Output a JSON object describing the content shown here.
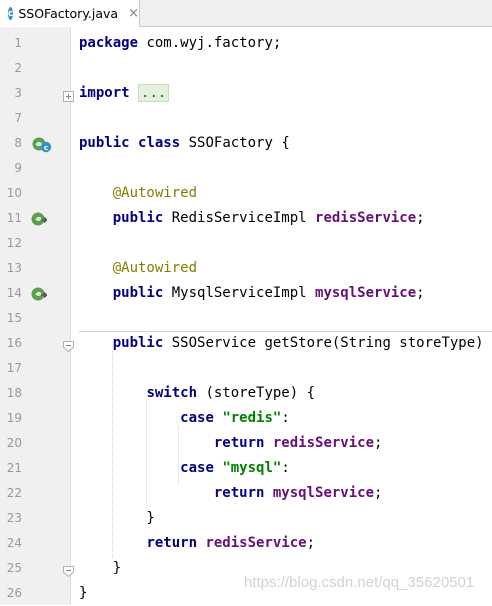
{
  "tab": {
    "label": "SSOFactory.java",
    "icon": "class-icon",
    "icon_letter": "c",
    "close_glyph": "×"
  },
  "lines": [
    {
      "n": "1",
      "tokens": [
        {
          "t": "package",
          "c": "kw"
        },
        {
          "t": " com.wyj.factory;"
        }
      ]
    },
    {
      "n": "2",
      "tokens": []
    },
    {
      "n": "3",
      "fold": "plus",
      "tokens": [
        {
          "t": "import",
          "c": "kw"
        },
        {
          "t": " "
        },
        {
          "t": "...",
          "c": "folded"
        }
      ]
    },
    {
      "n": "7",
      "tokens": []
    },
    {
      "n": "8",
      "icons": [
        "bean-icon",
        "class-icon"
      ],
      "tokens": [
        {
          "t": "public",
          "c": "kw"
        },
        {
          "t": " "
        },
        {
          "t": "class",
          "c": "kw"
        },
        {
          "t": " SSOFactory {"
        }
      ]
    },
    {
      "n": "9",
      "tokens": []
    },
    {
      "n": "10",
      "tokens": [
        {
          "t": "    "
        },
        {
          "t": "@Autowired",
          "c": "ann"
        }
      ]
    },
    {
      "n": "11",
      "icons": [
        "autowired-navigate-icon"
      ],
      "tokens": [
        {
          "t": "    "
        },
        {
          "t": "public",
          "c": "kw"
        },
        {
          "t": " RedisServiceImpl "
        },
        {
          "t": "redisService",
          "c": "fld"
        },
        {
          "t": ";"
        }
      ]
    },
    {
      "n": "12",
      "tokens": []
    },
    {
      "n": "13",
      "tokens": [
        {
          "t": "    "
        },
        {
          "t": "@Autowired",
          "c": "ann"
        }
      ]
    },
    {
      "n": "14",
      "icons": [
        "autowired-navigate-icon"
      ],
      "tokens": [
        {
          "t": "    "
        },
        {
          "t": "public",
          "c": "kw"
        },
        {
          "t": " MysqlServiceImpl "
        },
        {
          "t": "mysqlService",
          "c": "fld"
        },
        {
          "t": ";"
        }
      ]
    },
    {
      "n": "15",
      "tokens": []
    },
    {
      "n": "16",
      "fold": "minus",
      "tokens": [
        {
          "t": "    "
        },
        {
          "t": "public",
          "c": "kw"
        },
        {
          "t": " SSOService getStore(String storeType) {"
        }
      ]
    },
    {
      "n": "17",
      "tokens": []
    },
    {
      "n": "18",
      "tokens": [
        {
          "t": "        "
        },
        {
          "t": "switch",
          "c": "kw"
        },
        {
          "t": " (storeType) {"
        }
      ]
    },
    {
      "n": "19",
      "tokens": [
        {
          "t": "            "
        },
        {
          "t": "case",
          "c": "kw"
        },
        {
          "t": " "
        },
        {
          "t": "\"redis\"",
          "c": "str"
        },
        {
          "t": ":"
        }
      ]
    },
    {
      "n": "20",
      "tokens": [
        {
          "t": "                "
        },
        {
          "t": "return",
          "c": "kw"
        },
        {
          "t": " "
        },
        {
          "t": "redisService",
          "c": "fld"
        },
        {
          "t": ";"
        }
      ]
    },
    {
      "n": "21",
      "tokens": [
        {
          "t": "            "
        },
        {
          "t": "case",
          "c": "kw"
        },
        {
          "t": " "
        },
        {
          "t": "\"mysql\"",
          "c": "str"
        },
        {
          "t": ":"
        }
      ]
    },
    {
      "n": "22",
      "tokens": [
        {
          "t": "                "
        },
        {
          "t": "return",
          "c": "kw"
        },
        {
          "t": " "
        },
        {
          "t": "mysqlService",
          "c": "fld"
        },
        {
          "t": ";"
        }
      ]
    },
    {
      "n": "23",
      "tokens": [
        {
          "t": "        }"
        }
      ]
    },
    {
      "n": "24",
      "tokens": [
        {
          "t": "        "
        },
        {
          "t": "return",
          "c": "kw"
        },
        {
          "t": " "
        },
        {
          "t": "redisService",
          "c": "fld"
        },
        {
          "t": ";"
        }
      ]
    },
    {
      "n": "25",
      "fold": "minus",
      "tokens": [
        {
          "t": "    }"
        }
      ]
    },
    {
      "n": "26",
      "tokens": [
        {
          "t": "}"
        }
      ]
    }
  ],
  "watermark": "https://blog.csdn.net/qq_35620501",
  "colors": {
    "keyword": "#000080",
    "annotation": "#808000",
    "field": "#660e7a",
    "string": "#008000",
    "gutter_bg": "#f0f0f0",
    "line_number": "#999999"
  }
}
